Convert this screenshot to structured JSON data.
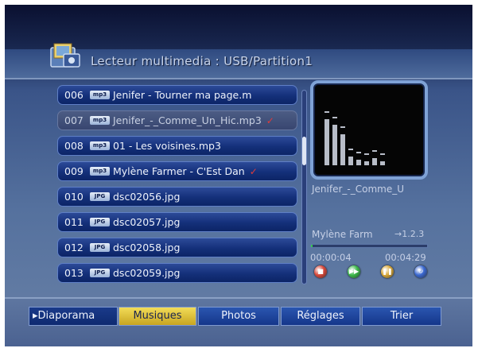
{
  "header": {
    "title": "Lecteur multimedia : USB/Partition1",
    "icon": "media-folder-icon"
  },
  "file_list": [
    {
      "num": "006",
      "type": "mp3",
      "name": "Jenifer - Tourner ma page.m",
      "checked": false,
      "state": "normal"
    },
    {
      "num": "007",
      "type": "mp3",
      "name": "Jenifer_-_Comme_Un_Hic.mp3",
      "checked": true,
      "state": "playing"
    },
    {
      "num": "008",
      "type": "mp3",
      "name": "01 - Les voisines.mp3",
      "checked": false,
      "state": "normal"
    },
    {
      "num": "009",
      "type": "mp3",
      "name": "Mylène Farmer - C'Est Dan",
      "checked": true,
      "state": "normal"
    },
    {
      "num": "010",
      "type": "jpg",
      "name": "dsc02056.jpg",
      "checked": false,
      "state": "normal"
    },
    {
      "num": "011",
      "type": "jpg",
      "name": "dsc02057.jpg",
      "checked": false,
      "state": "normal"
    },
    {
      "num": "012",
      "type": "jpg",
      "name": "dsc02058.jpg",
      "checked": false,
      "state": "normal"
    },
    {
      "num": "013",
      "type": "jpg",
      "name": "dsc02059.jpg",
      "checked": false,
      "state": "normal"
    }
  ],
  "badges": {
    "mp3": "mp3",
    "jpg": "JPG"
  },
  "check_mark": "✓",
  "player": {
    "now_playing": "Jenifer_-_Comme_U",
    "next_track": "Mylène Farm",
    "next_index": "→1.2.3",
    "elapsed": "00:00:04",
    "total": "00:04:29",
    "progress": 0.015,
    "spectrum_levels": [
      0.62,
      0.55,
      0.42,
      0.12,
      0.08,
      0.05,
      0.1,
      0.05
    ],
    "controls": [
      {
        "name": "stop-control-icon",
        "glyph": "■",
        "color": "#d8483a"
      },
      {
        "name": "next-control-icon",
        "glyph": "▶▶",
        "color": "#3bb84a"
      },
      {
        "name": "pause-control-icon",
        "glyph": "❚❚",
        "color": "#d8a83a"
      },
      {
        "name": "repeat-control-icon",
        "glyph": "↻",
        "color": "#3a68d0"
      }
    ]
  },
  "tabs": {
    "diaporama": "▸Diaporama",
    "musiques": "Musiques",
    "photos": "Photos",
    "reglages": "Réglages",
    "trier": "Trier",
    "active": "musiques"
  },
  "colors": {
    "accent_active_tab": "#e8c840",
    "row_normal": "#1a3a8a",
    "row_playing": "#44547c",
    "check_mark": "#e03a3a",
    "progress": "#36c850"
  }
}
